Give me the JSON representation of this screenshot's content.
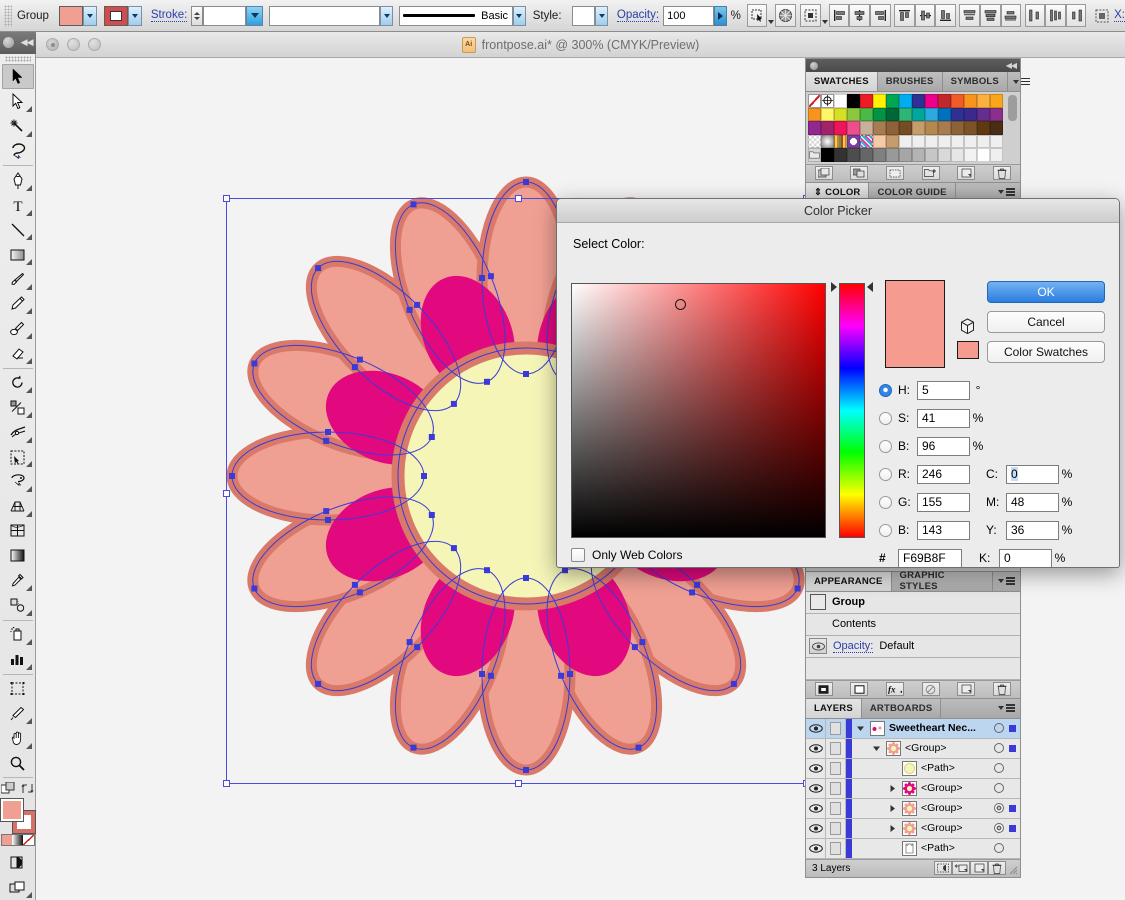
{
  "control_bar": {
    "selection_label": "Group",
    "stroke_label": "Stroke:",
    "stroke_weight": "",
    "stroke_profile": "",
    "brush_label": "Basic",
    "style_label": "Style:",
    "opacity_label": "Opacity:",
    "opacity_value": "100",
    "opacity_unit": "%",
    "transform_label": "X:",
    "fill_color": "#F0A093",
    "stroke_color": "#D04D4D"
  },
  "document": {
    "title": "frontpose.ai* @ 300% (CMYK/Preview)",
    "app_icon": "Ai"
  },
  "toolbar": {
    "tools": [
      {
        "name": "selection-tool",
        "selected": true
      },
      {
        "name": "direct-selection-tool",
        "selected": false
      },
      {
        "name": "magic-wand-tool",
        "selected": false
      },
      {
        "name": "lasso-tool",
        "selected": false
      },
      {
        "name": "pen-tool",
        "selected": false
      },
      {
        "name": "type-tool",
        "selected": false
      },
      {
        "name": "line-segment-tool",
        "selected": false
      },
      {
        "name": "rectangle-tool",
        "selected": false
      },
      {
        "name": "paintbrush-tool",
        "selected": false
      },
      {
        "name": "pencil-tool",
        "selected": false
      },
      {
        "name": "blob-brush-tool",
        "selected": false
      },
      {
        "name": "eraser-tool",
        "selected": false
      },
      {
        "name": "rotate-tool",
        "selected": false
      },
      {
        "name": "scale-tool",
        "selected": false
      },
      {
        "name": "width-tool",
        "selected": false
      },
      {
        "name": "shape-builder-tool",
        "selected": false
      },
      {
        "name": "free-transform-tool",
        "selected": false
      },
      {
        "name": "perspective-grid-tool",
        "selected": false
      },
      {
        "name": "mesh-tool",
        "selected": false
      },
      {
        "name": "gradient-tool",
        "selected": false
      },
      {
        "name": "eyedropper-tool",
        "selected": false
      },
      {
        "name": "blend-tool",
        "selected": false
      },
      {
        "name": "symbol-sprayer-tool",
        "selected": false
      },
      {
        "name": "column-graph-tool",
        "selected": false
      },
      {
        "name": "artboard-tool",
        "selected": false
      },
      {
        "name": "slice-tool",
        "selected": false
      },
      {
        "name": "hand-tool",
        "selected": false
      },
      {
        "name": "zoom-tool",
        "selected": false
      }
    ],
    "fill_color": "#F0A093",
    "stroke_color": "#D8706A"
  },
  "swatches_panel": {
    "tabs": [
      "SWATCHES",
      "BRUSHES",
      "SYMBOLS"
    ],
    "active_tab": "SWATCHES",
    "colors": [
      "none",
      "registration",
      "#FFFFFF",
      "#000000",
      "#ED1C24",
      "#FFF200",
      "#00A651",
      "#00AEEF",
      "#2E3192",
      "#EC008C",
      "#C1272D",
      "#F15A29",
      "#F7941E",
      "#FBB040",
      "#F9A61A",
      "#F7941E",
      "#FFF568",
      "#D7DF23",
      "#8DC63F",
      "#4CB848",
      "#009444",
      "#006838",
      "#2BB673",
      "#00A79D",
      "#29ABE2",
      "#0071BC",
      "#2E3192",
      "#3B2A8E",
      "#662D91",
      "#8B2F8E",
      "#92278F",
      "#A1246B",
      "#ED145B",
      "#EF4E8C",
      "#C7B299",
      "#A67C52",
      "#8C6239",
      "#754C24",
      "#C69C6D",
      "#B5894E",
      "#A97C50",
      "#8C6239",
      "#7C5329",
      "#603913",
      "#4B2C14",
      "#CCCCCC",
      "#BFBFBF",
      "#E8D44D",
      "#FFFFFF",
      "#E7408C",
      "#F5CBA7",
      "#C69C6D",
      "#EFEFEF",
      "#EFEFEF",
      "#EFEFEF",
      "#EFEFEF",
      "#EFEFEF",
      "#EFEFEF",
      "#EFEFEF",
      "#EFEFEF",
      "#D6D6D6",
      "#000000",
      "#333333",
      "#4D4D4D",
      "#666666",
      "#808080",
      "#999999",
      "#A6A6A6",
      "#B3B3B3",
      "#C6C6C6",
      "#D9D9D9",
      "#E6E6E6",
      "#F2F2F2",
      "#FFFFFF",
      "#EFEFEF"
    ]
  },
  "color_panel": {
    "tabs": [
      "COLOR",
      "COLOR GUIDE"
    ],
    "active_tab": "COLOR"
  },
  "appearance_panel": {
    "tabs": [
      "APPEARANCE",
      "GRAPHIC STYLES"
    ],
    "active_tab": "APPEARANCE",
    "rows": [
      {
        "label": "Group",
        "type": "header"
      },
      {
        "label": "Contents",
        "type": "item"
      },
      {
        "label": "Opacity:",
        "value": "Default",
        "type": "opacity"
      }
    ]
  },
  "layers_panel": {
    "tabs": [
      "LAYERS",
      "ARTBOARDS"
    ],
    "active_tab": "LAYERS",
    "rows": [
      {
        "name": "Sweetheart Nec...",
        "indent": 0,
        "expanded": true,
        "selected": true,
        "thumb": "#FFFFFF",
        "color": "#3A3AD8",
        "target": "single",
        "selsq": "#3A3AD8"
      },
      {
        "name": "<Group>",
        "indent": 1,
        "expanded": true,
        "selected": false,
        "thumb": "#F0A093",
        "color": "#3A3AD8",
        "target": "single",
        "selsq": "#3A3AD8"
      },
      {
        "name": "<Path>",
        "indent": 2,
        "expanded": false,
        "selected": false,
        "thumb": "#F5F5B8",
        "color": "#3A3AD8",
        "target": "single",
        "selsq": ""
      },
      {
        "name": "<Group>",
        "indent": 2,
        "expanded": false,
        "selected": false,
        "thumb": "#E2097E",
        "color": "#3A3AD8",
        "target": "single",
        "selsq": ""
      },
      {
        "name": "<Group>",
        "indent": 2,
        "expanded": false,
        "selected": false,
        "thumb": "#F0A093",
        "color": "#3A3AD8",
        "target": "double",
        "selsq": "#3A3AD8"
      },
      {
        "name": "<Group>",
        "indent": 2,
        "expanded": false,
        "selected": false,
        "thumb": "#F0A093",
        "color": "#3A3AD8",
        "target": "double",
        "selsq": "#3A3AD8"
      },
      {
        "name": "<Path>",
        "indent": 2,
        "expanded": false,
        "selected": false,
        "thumb": "#FFFFFF",
        "color": "#3A3AD8",
        "target": "single",
        "selsq": ""
      }
    ],
    "footer_count": "3 Layers"
  },
  "color_picker": {
    "title": "Color Picker",
    "select_label": "Select Color:",
    "ok_label": "OK",
    "cancel_label": "Cancel",
    "swatches_label": "Color Swatches",
    "only_web_colors_label": "Only Web Colors",
    "only_web_colors_checked": false,
    "preview_color": "#F69B8F",
    "current_color": "#F69B8F",
    "marker_x_pct": 43,
    "marker_y_pct": 8,
    "hue_pct": 1.4,
    "hsb": [
      {
        "key": "H:",
        "value": "5",
        "unit": "°",
        "selected": true
      },
      {
        "key": "S:",
        "value": "41",
        "unit": "%",
        "selected": false
      },
      {
        "key": "B:",
        "value": "96",
        "unit": "%",
        "selected": false
      }
    ],
    "rgb": [
      {
        "key": "R:",
        "value": "246",
        "selected": false
      },
      {
        "key": "G:",
        "value": "155",
        "selected": false
      },
      {
        "key": "B:",
        "value": "143",
        "selected": false
      }
    ],
    "cmyk": [
      {
        "key": "C:",
        "value": "0",
        "unit": "%",
        "highlighted": true
      },
      {
        "key": "M:",
        "value": "48",
        "unit": "%",
        "highlighted": false
      },
      {
        "key": "Y:",
        "value": "36",
        "unit": "%",
        "highlighted": false
      },
      {
        "key": "K:",
        "value": "0",
        "unit": "%",
        "highlighted": false
      }
    ],
    "hex_label": "#",
    "hex_value": "F69B8F"
  },
  "artwork": {
    "petal_fill": "#F0A093",
    "petal_stroke": "#D9796A",
    "inner_petal_fill": "#E2097E",
    "center_fill": "#F5F5B8",
    "center_stroke": "#D9796A",
    "path_color": "#3A3AD8",
    "outer_petals": 16,
    "inner_petals": 8
  }
}
